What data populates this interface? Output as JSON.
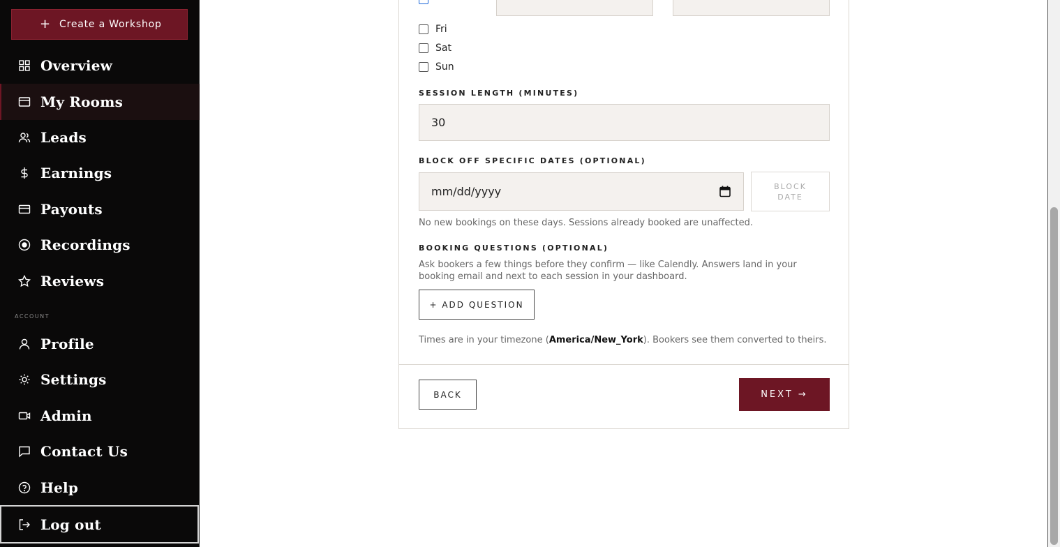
{
  "sidebar": {
    "create_label": "Create a Workshop",
    "items": [
      {
        "label": "Overview",
        "icon": "grid-icon"
      },
      {
        "label": "My Rooms",
        "icon": "rooms-icon",
        "active": true
      },
      {
        "label": "Leads",
        "icon": "users-icon"
      },
      {
        "label": "Earnings",
        "icon": "dollar-icon"
      },
      {
        "label": "Payouts",
        "icon": "card-icon"
      },
      {
        "label": "Recordings",
        "icon": "record-icon"
      },
      {
        "label": "Reviews",
        "icon": "star-icon"
      }
    ],
    "section_label": "ACCOUNT",
    "account_items": [
      {
        "label": "Profile",
        "icon": "user-icon"
      },
      {
        "label": "Settings",
        "icon": "sun-icon"
      },
      {
        "label": "Admin",
        "icon": "video-icon"
      },
      {
        "label": "Contact Us",
        "icon": "chat-icon"
      },
      {
        "label": "Help",
        "icon": "help-icon"
      }
    ],
    "logout_label": "Log out",
    "accent": "#6d1624"
  },
  "form": {
    "days": [
      {
        "label": "Fri",
        "checked": false
      },
      {
        "label": "Sat",
        "checked": false
      },
      {
        "label": "Sun",
        "checked": false
      }
    ],
    "session_length_label": "SESSION LENGTH (MINUTES)",
    "session_length_value": "30",
    "block_dates_label": "BLOCK OFF SPECIFIC DATES (OPTIONAL)",
    "date_placeholder": "mm/dd/yyyy",
    "block_date_button": "BLOCK DATE",
    "block_help": "No new bookings on these days. Sessions already booked are unaffected.",
    "questions_label": "BOOKING QUESTIONS (OPTIONAL)",
    "questions_help": "Ask bookers a few things before they confirm — like Calendly. Answers land in your booking email and next to each session in your dashboard.",
    "add_question_button": "+ ADD QUESTION",
    "tz_prefix": "Times are in your timezone (",
    "tz_value": "America/New_York",
    "tz_suffix": "). Bookers see them converted to theirs.",
    "back_button": "BACK",
    "next_button": "NEXT →"
  }
}
